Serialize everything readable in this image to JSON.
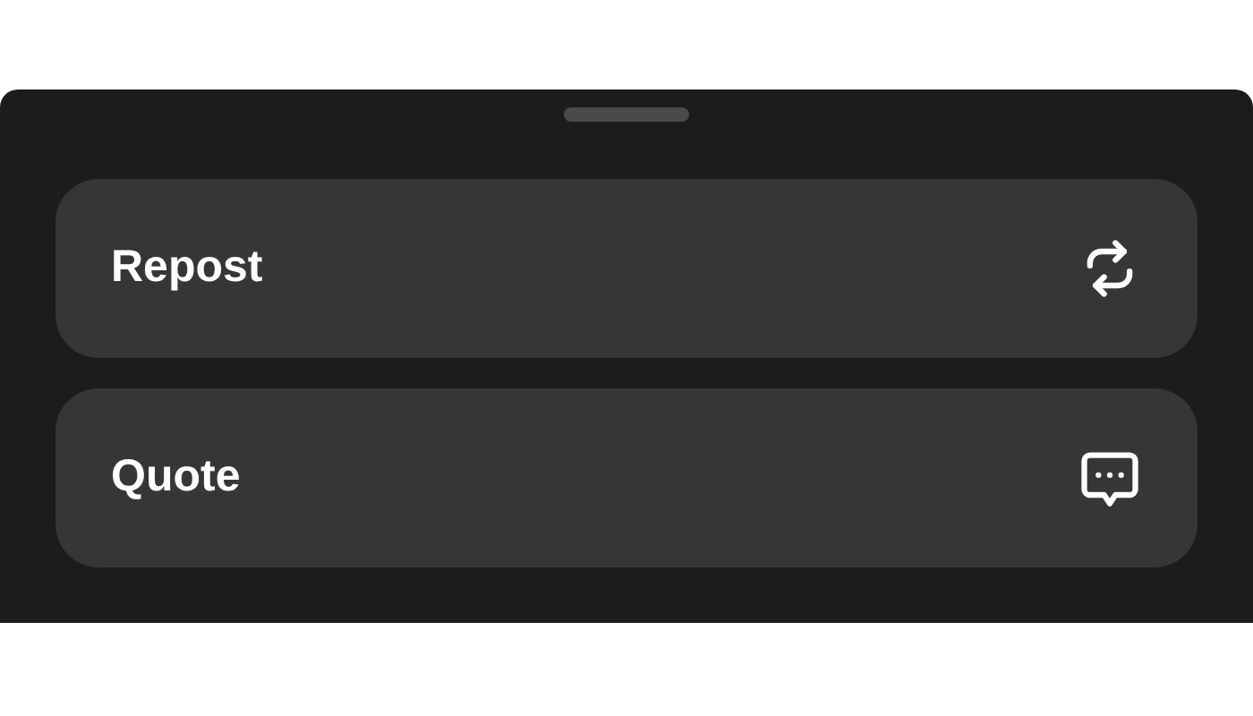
{
  "options": [
    {
      "label": "Repost",
      "kind": "repost"
    },
    {
      "label": "Quote",
      "kind": "quote"
    }
  ]
}
